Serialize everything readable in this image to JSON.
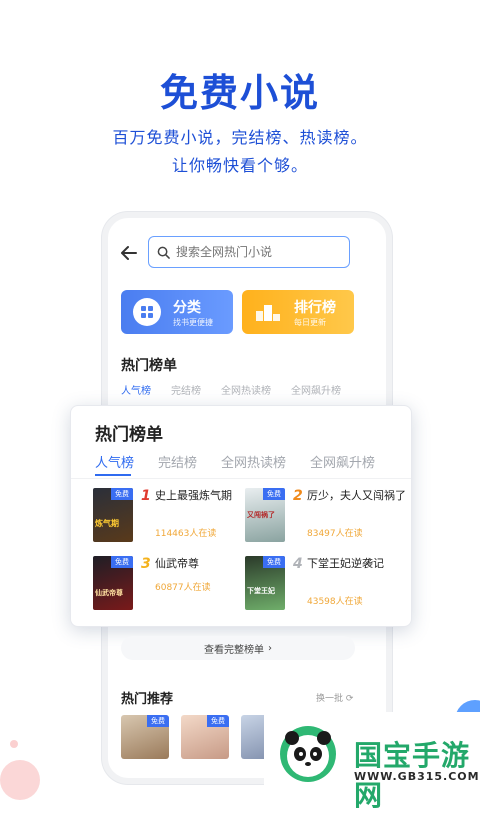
{
  "hero": {
    "title": "免费小说",
    "subtitle_line1": "百万免费小说，完结榜、热读榜。",
    "subtitle_line2": "让你畅快看个够。"
  },
  "search": {
    "placeholder": "搜索全网热门小说"
  },
  "quick_cards": {
    "category": {
      "title": "分类",
      "subtitle": "找书更便捷"
    },
    "ranking": {
      "title": "排行榜",
      "subtitle": "每日更新"
    }
  },
  "inner_section": {
    "title": "热门榜单",
    "tabs": [
      "人气榜",
      "完结榜",
      "全网热读榜",
      "全网飙升榜"
    ],
    "active_tab": "人气榜"
  },
  "popular_list": {
    "title": "热门榜单",
    "tabs": [
      "人气榜",
      "完结榜",
      "全网热读榜",
      "全网飙升榜"
    ],
    "active_tab": "人气榜",
    "books": [
      {
        "rank": "1",
        "title": "史上最强炼气期",
        "readers": "114463人在读",
        "badge": "免费",
        "cover_text": "炼气期"
      },
      {
        "rank": "2",
        "title": "厉少，夫人又闯祸了",
        "readers": "83497人在读",
        "badge": "免费",
        "cover_text": "又闯祸了"
      },
      {
        "rank": "3",
        "title": "仙武帝尊",
        "readers": "60877人在读",
        "badge": "免费",
        "cover_text": "仙武帝尊"
      },
      {
        "rank": "4",
        "title": "下堂王妃逆袭记",
        "readers": "43598人在读",
        "badge": "免费",
        "cover_text": "下堂王妃"
      }
    ],
    "rank_colors": [
      "#e03b2f",
      "#f08a1c",
      "#f4b21c",
      "#b0b3b8"
    ]
  },
  "view_full_list": {
    "label": "查看完整榜单"
  },
  "recommend": {
    "title": "热门推荐",
    "refresh_label": "换一批",
    "badges": [
      "免费",
      "免费",
      "免费",
      "免费"
    ]
  },
  "watermark": {
    "name": "国宝手游网",
    "url": "WWW.GB315.COM"
  },
  "colors": {
    "brand_blue": "#1d4fd6",
    "accent_blue": "#2f6bf0",
    "orange": "#ffb11c",
    "reader_count": "#f0a83a"
  }
}
